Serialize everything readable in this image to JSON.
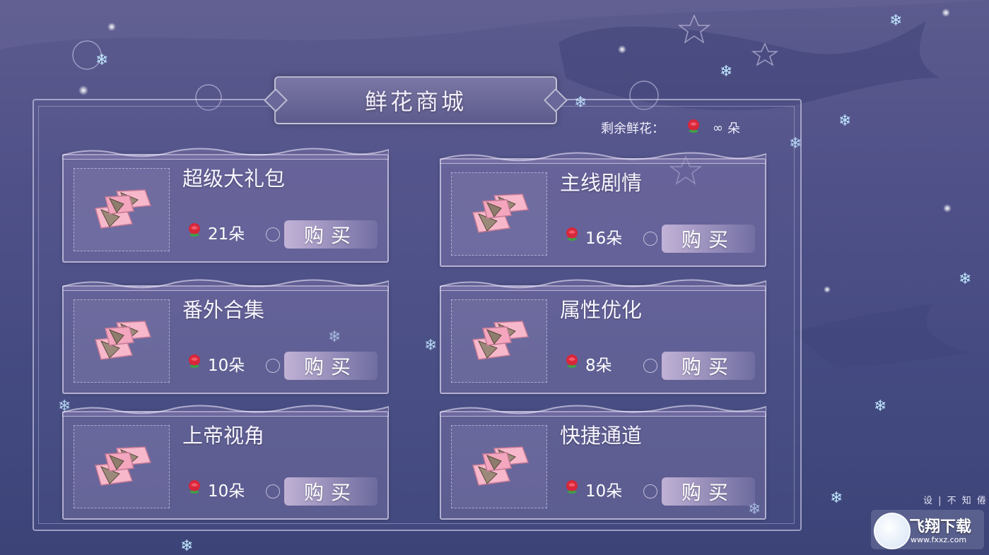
{
  "title": "鲜花商城",
  "remaining": {
    "label": "剩余鲜花：",
    "value": "∞",
    "unit": "朵"
  },
  "items": [
    {
      "name": "超级大礼包",
      "price": "21朵",
      "buy_label": "购买"
    },
    {
      "name": "主线剧情",
      "price": "16朵",
      "buy_label": "购买"
    },
    {
      "name": "番外合集",
      "price": "10朵",
      "buy_label": "购买"
    },
    {
      "name": "属性优化",
      "price": "8朵",
      "buy_label": "购买"
    },
    {
      "name": "上帝视角",
      "price": "10朵",
      "buy_label": "购买"
    },
    {
      "name": "快捷通道",
      "price": "10朵",
      "buy_label": "购买"
    }
  ],
  "settings_text": "设 | 不 知 倦",
  "watermark": {
    "title": "飞翔下载",
    "url": "www.fxxz.com"
  },
  "colors": {
    "background": "#4f5088",
    "rose": "#d8263a",
    "card_border": "#ebe6fa"
  }
}
